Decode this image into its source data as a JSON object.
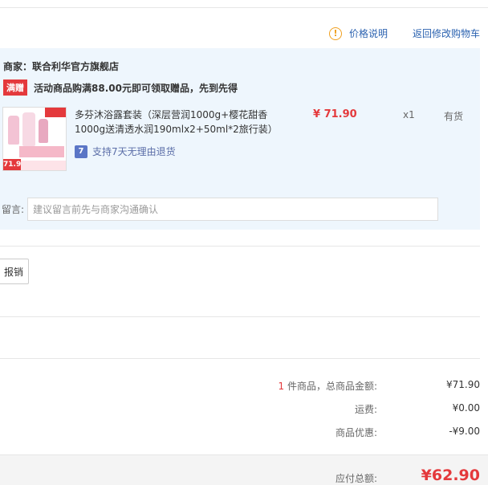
{
  "header": {
    "price_note": "价格说明",
    "back_to_cart": "返回修改购物车",
    "info_icon": "info-icon"
  },
  "shop": {
    "merchant": "商家：联合利华官方旗舰店",
    "promo_tag": "满赠",
    "promo_text": "活动商品购满88.00元即可领取赠品，先到先得",
    "item": {
      "name": "多芬沐浴露套装（深层营润1000g+樱花甜香1000g送清透水润190mlx2+50ml*2旅行装）",
      "price": "¥ 71.90",
      "qty": "x1",
      "stock": "有货",
      "return_icon_text": "7",
      "return_policy": "支持7天无理由退货",
      "thumb_price": "71.9"
    },
    "message": {
      "label": "留言:",
      "placeholder": "建议留言前先与商家沟通确认"
    }
  },
  "claim_button": "报销",
  "summary": {
    "count": "1",
    "count_suffix": " 件商品，总商品金额:",
    "goods_total": "¥71.90",
    "shipping_label": "运费:",
    "shipping": "¥0.00",
    "discount_label": "商品优惠:",
    "discount": "-¥9.00"
  },
  "total": {
    "label": "应付总额:",
    "value": "¥62.90"
  },
  "colors": {
    "accent_red": "#e4393c",
    "link_blue": "#2b62b0",
    "shop_bg": "#eef6fd"
  }
}
